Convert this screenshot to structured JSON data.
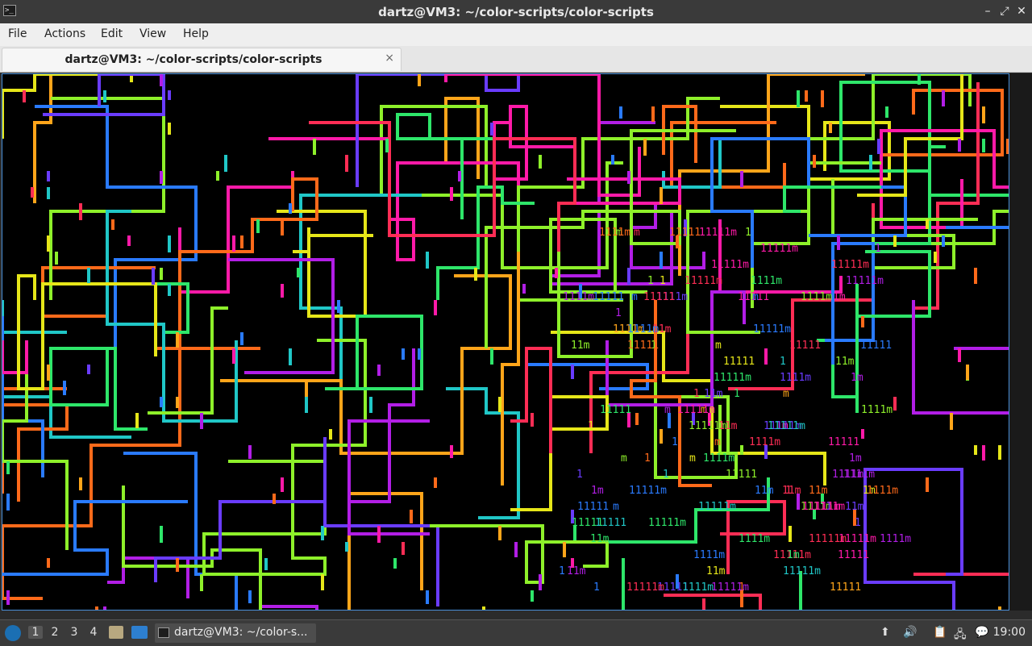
{
  "window": {
    "title": "dartz@VM3: ~/color-scripts/color-scripts",
    "icon": "terminal-icon",
    "controls": [
      "minimize-icon",
      "restore-icon",
      "close-icon"
    ]
  },
  "menu": [
    "File",
    "Actions",
    "Edit",
    "View",
    "Help"
  ],
  "tab": {
    "label": "dartz@VM3: ~/color-scripts/color-scripts",
    "close_glyph": "×"
  },
  "terminal": {
    "background": "#000000",
    "palette": [
      "#ff2d55",
      "#ff6a1a",
      "#ffa51a",
      "#e6e619",
      "#8ef02a",
      "#2ee66a",
      "#20c7c7",
      "#2a7bff",
      "#6a3cff",
      "#b21ee6",
      "#ff1aa8"
    ],
    "fragments": [
      "1m",
      "m",
      "1111m",
      "11111m",
      "11111",
      "1",
      "11m"
    ]
  },
  "taskbar": {
    "start_icon": "lxqt-menu-icon",
    "workspaces": [
      "1",
      "2",
      "3",
      "4"
    ],
    "active_workspace": "1",
    "quicklaunch": [
      "file-manager-icon",
      "show-desktop-icon"
    ],
    "task_label": "dartz@VM3: ~/color-s...",
    "tray_icons": [
      "update-icon",
      "volume-icon",
      "clipboard-icon",
      "network-icon",
      "chat-icon"
    ],
    "clock": "19:00"
  }
}
